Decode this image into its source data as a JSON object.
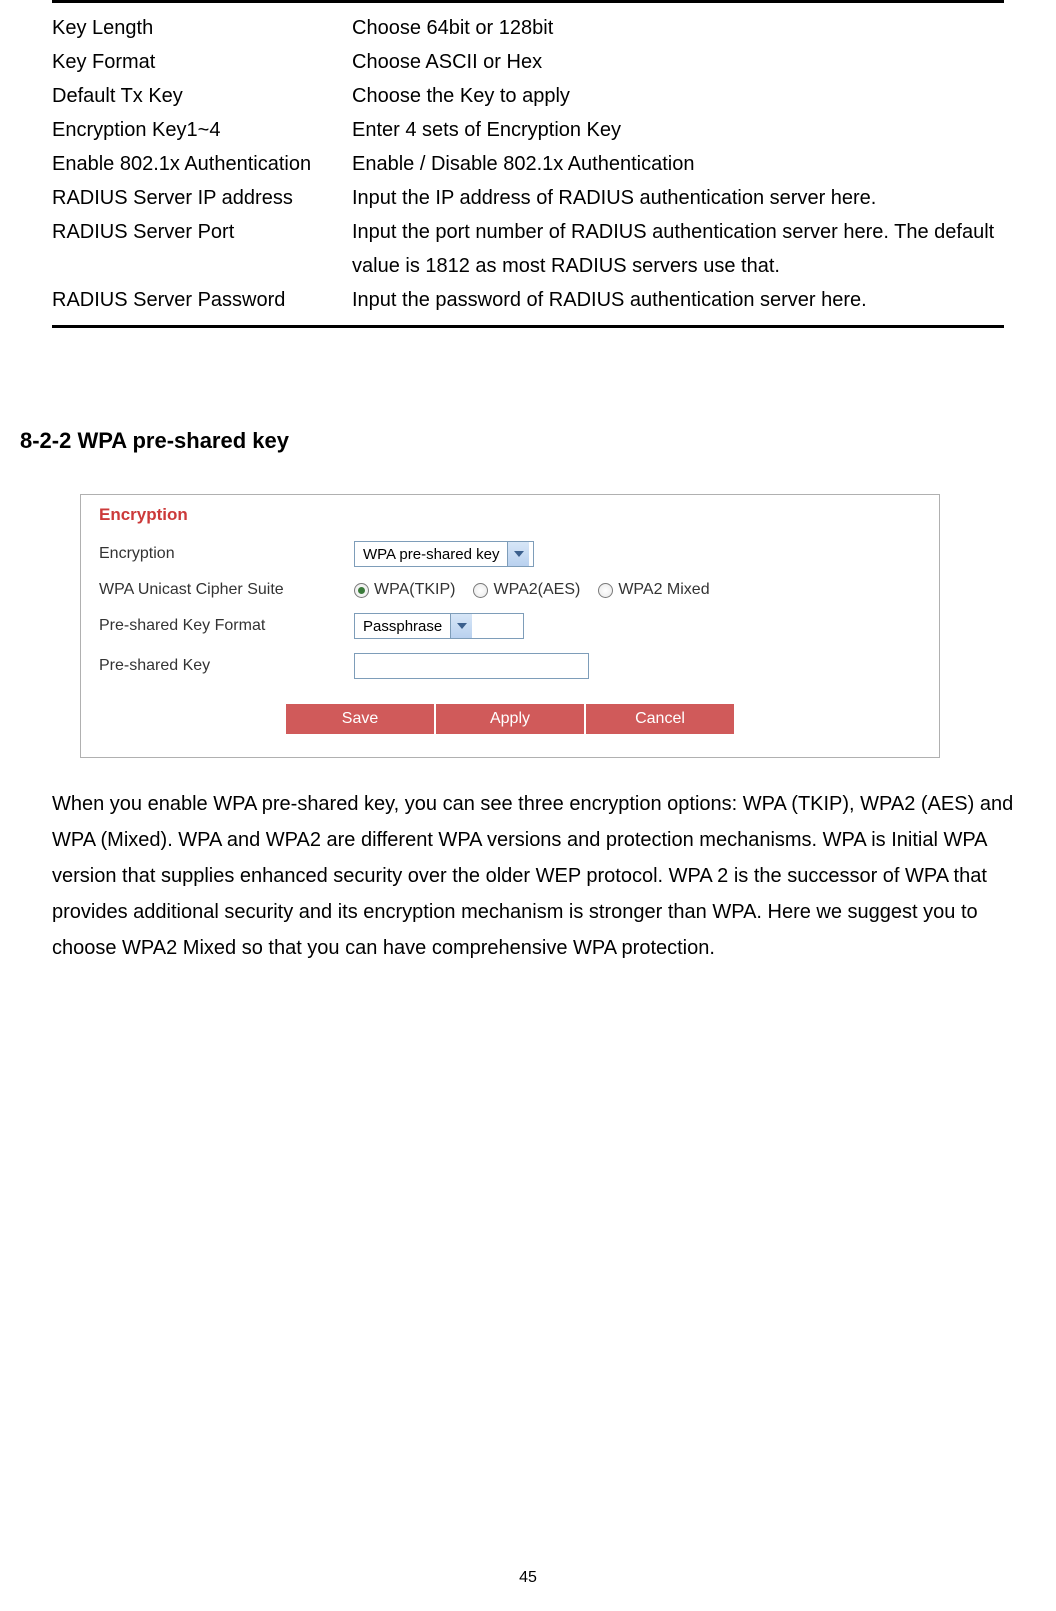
{
  "paramTable": [
    {
      "label": "Key Length",
      "desc": "Choose 64bit or 128bit"
    },
    {
      "label": "Key Format",
      "desc": "Choose ASCII or Hex"
    },
    {
      "label": "Default Tx Key",
      "desc": "Choose the Key to apply"
    },
    {
      "label": "Encryption Key1~4",
      "desc": "Enter 4 sets of Encryption Key"
    },
    {
      "label": "Enable 802.1x Authentication",
      "desc": "Enable / Disable 802.1x Authentication"
    },
    {
      "label": "RADIUS Server IP address",
      "desc": "Input the IP address of RADIUS authentication server here."
    },
    {
      "label": "RADIUS Server Port",
      "desc": "Input the port number of RADIUS authentication server here. The default value is 1812 as most RADIUS servers use that."
    },
    {
      "label": "RADIUS Server Password",
      "desc": "Input the password of RADIUS authentication server here."
    }
  ],
  "sectionHeading": "8-2-2 WPA pre-shared key",
  "encryptionPanel": {
    "legend": "Encryption",
    "rows": {
      "encryptionLabel": "Encryption",
      "encryptionValue": "WPA pre-shared key",
      "cipherLabel": "WPA Unicast Cipher Suite",
      "cipherOptions": [
        {
          "label": "WPA(TKIP)",
          "selected": true
        },
        {
          "label": "WPA2(AES)",
          "selected": false
        },
        {
          "label": "WPA2 Mixed",
          "selected": false
        }
      ],
      "keyFormatLabel": "Pre-shared Key Format",
      "keyFormatValue": "Passphrase",
      "preSharedKeyLabel": "Pre-shared Key",
      "preSharedKeyValue": ""
    },
    "buttons": {
      "save": "Save",
      "apply": "Apply",
      "cancel": "Cancel"
    }
  },
  "bodyText": "When you enable WPA pre-shared key, you can see three encryption options: WPA (TKIP), WPA2 (AES) and WPA (Mixed). WPA and WPA2 are different WPA versions and protection mechanisms. WPA is Initial WPA version that supplies enhanced security over the older WEP protocol. WPA 2 is the successor of WPA that provides additional security and its encryption mechanism is stronger than WPA. Here we suggest you to choose WPA2 Mixed so that you can have comprehensive WPA protection.",
  "pageNumber": "45"
}
